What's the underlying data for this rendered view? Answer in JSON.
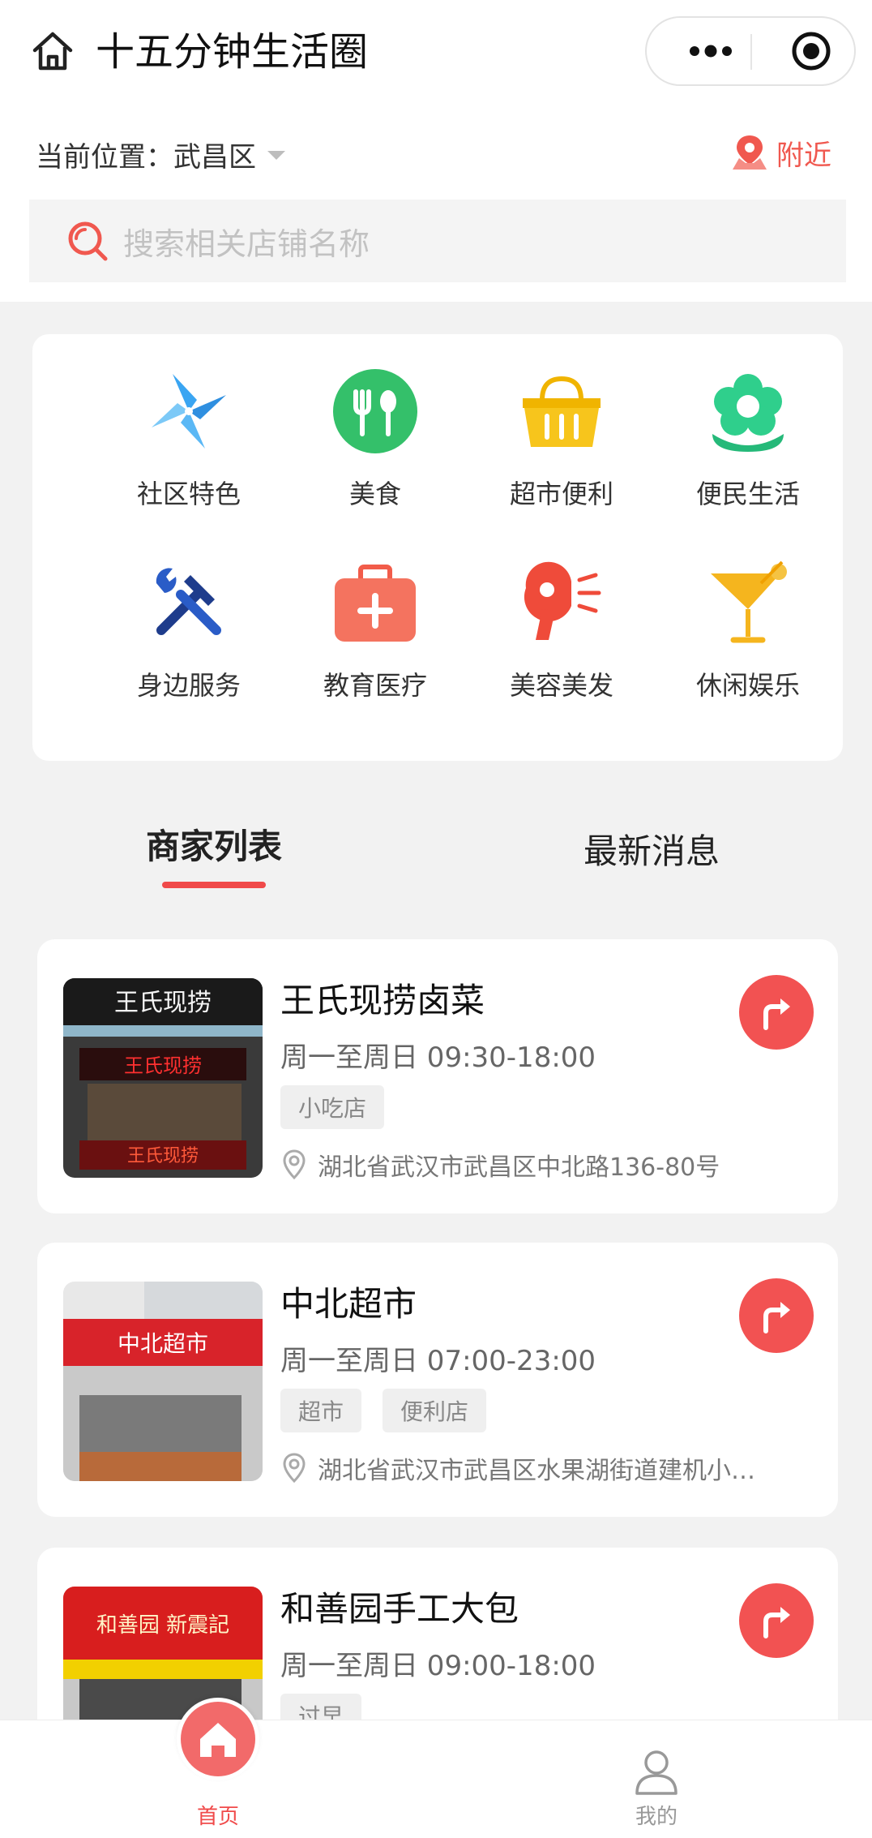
{
  "header": {
    "title": "十五分钟生活圈"
  },
  "location": {
    "label": "当前位置：",
    "value": "武昌区",
    "nearby_label": "附近"
  },
  "search": {
    "placeholder": "搜索相关店铺名称"
  },
  "categories": [
    {
      "label": "社区特色",
      "icon": "pinwheel-icon",
      "color": "#3aa5f2"
    },
    {
      "label": "美食",
      "icon": "fork-spoon-icon",
      "color": "#34c06a"
    },
    {
      "label": "超市便利",
      "icon": "basket-icon",
      "color": "#f5c21a"
    },
    {
      "label": "便民生活",
      "icon": "flower-icon",
      "color": "#2fcf8c"
    },
    {
      "label": "身边服务",
      "icon": "tools-icon",
      "color": "#1e3c8c"
    },
    {
      "label": "教育医疗",
      "icon": "medical-kit-icon",
      "color": "#f25c4a"
    },
    {
      "label": "美容美发",
      "icon": "hair-dryer-icon",
      "color": "#ef4b3a"
    },
    {
      "label": "休闲娱乐",
      "icon": "cocktail-icon",
      "color": "#f5b51e"
    }
  ],
  "tabs": [
    {
      "label": "商家列表",
      "active": true
    },
    {
      "label": "最新消息",
      "active": false
    }
  ],
  "shops": [
    {
      "name": "王氏现捞卤菜",
      "hours": "周一至周日 09:30-18:00",
      "tags": [
        "小吃店"
      ],
      "address": "湖北省武汉市武昌区中北路136-80号",
      "sign_text": "王氏现捞"
    },
    {
      "name": "中北超市",
      "hours": "周一至周日 07:00-23:00",
      "tags": [
        "超市",
        "便利店"
      ],
      "address": "湖北省武汉市武昌区水果湖街道建机小…",
      "sign_text": "中北超市"
    },
    {
      "name": "和善园手工大包",
      "hours": "周一至周日 09:00-18:00",
      "tags": [
        "过早"
      ],
      "address": "",
      "sign_text": "和善园 新震記"
    }
  ],
  "tabbar": {
    "home_label": "首页",
    "me_label": "我的"
  },
  "colors": {
    "accent": "#f04a4a",
    "background": "#f2f2f2"
  }
}
